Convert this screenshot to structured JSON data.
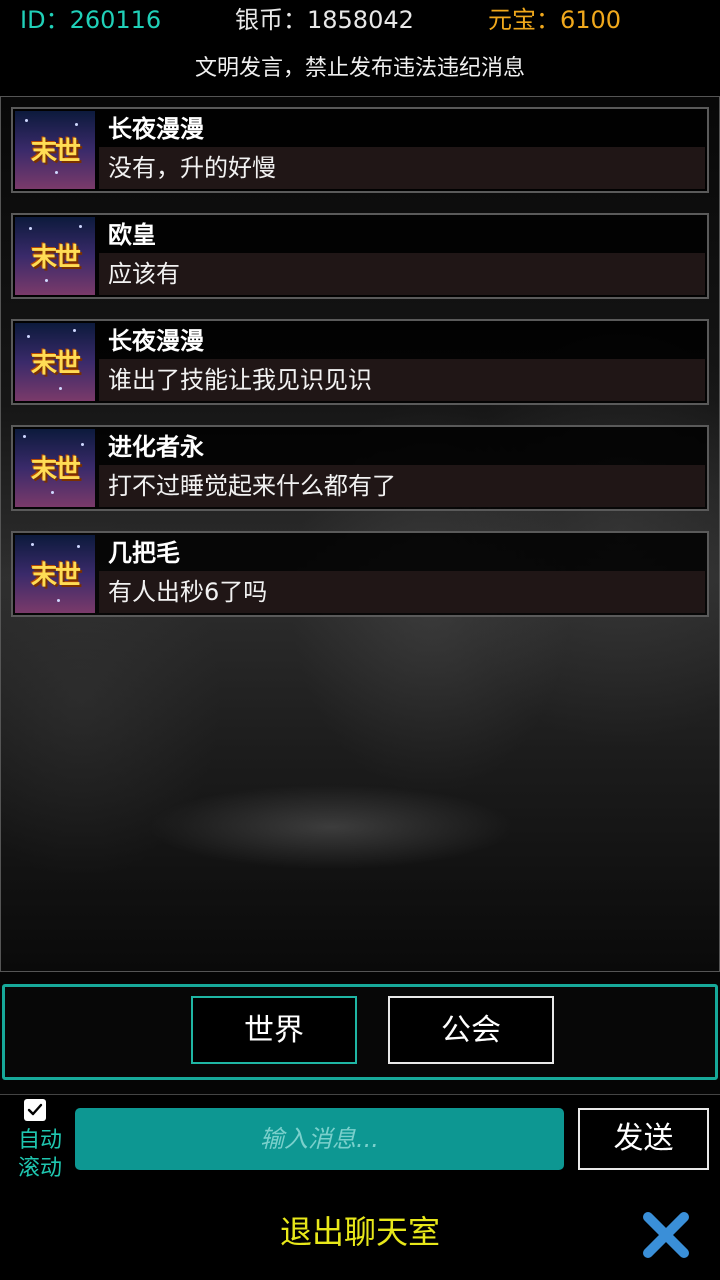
{
  "header": {
    "id_label": "ID：",
    "id_value": "260116",
    "silver_label": "银币：",
    "silver_value": "1858042",
    "gold_label": "元宝：",
    "gold_value": "6100",
    "notice": "文明发言，禁止发布违法违纪消息"
  },
  "messages": [
    {
      "avatar_text": "末世",
      "name": "长夜漫漫",
      "text": "没有，升的好慢"
    },
    {
      "avatar_text": "末世",
      "name": "欧皇",
      "text": "应该有"
    },
    {
      "avatar_text": "末世",
      "name": "长夜漫漫",
      "text": "谁出了技能让我见识见识"
    },
    {
      "avatar_text": "末世",
      "name": "进化者永",
      "text": "打不过睡觉起来什么都有了"
    },
    {
      "avatar_text": "末世",
      "name": "几把毛",
      "text": "有人出秒6了吗"
    }
  ],
  "tabs": {
    "world": "世界",
    "guild": "公会",
    "selected": "world"
  },
  "input": {
    "autoscroll_label_1": "自动",
    "autoscroll_label_2": "滚动",
    "autoscroll_checked": true,
    "placeholder": "输入消息...",
    "value": "",
    "send_label": "发送"
  },
  "footer": {
    "exit_label": "退出聊天室",
    "close_icon": "close-icon"
  },
  "colors": {
    "accent_teal": "#17a99a",
    "gold": "#f0a81c",
    "id_color": "#20d0b8",
    "exit_yellow": "#e8e81a",
    "close_blue": "#3a8fd8"
  }
}
